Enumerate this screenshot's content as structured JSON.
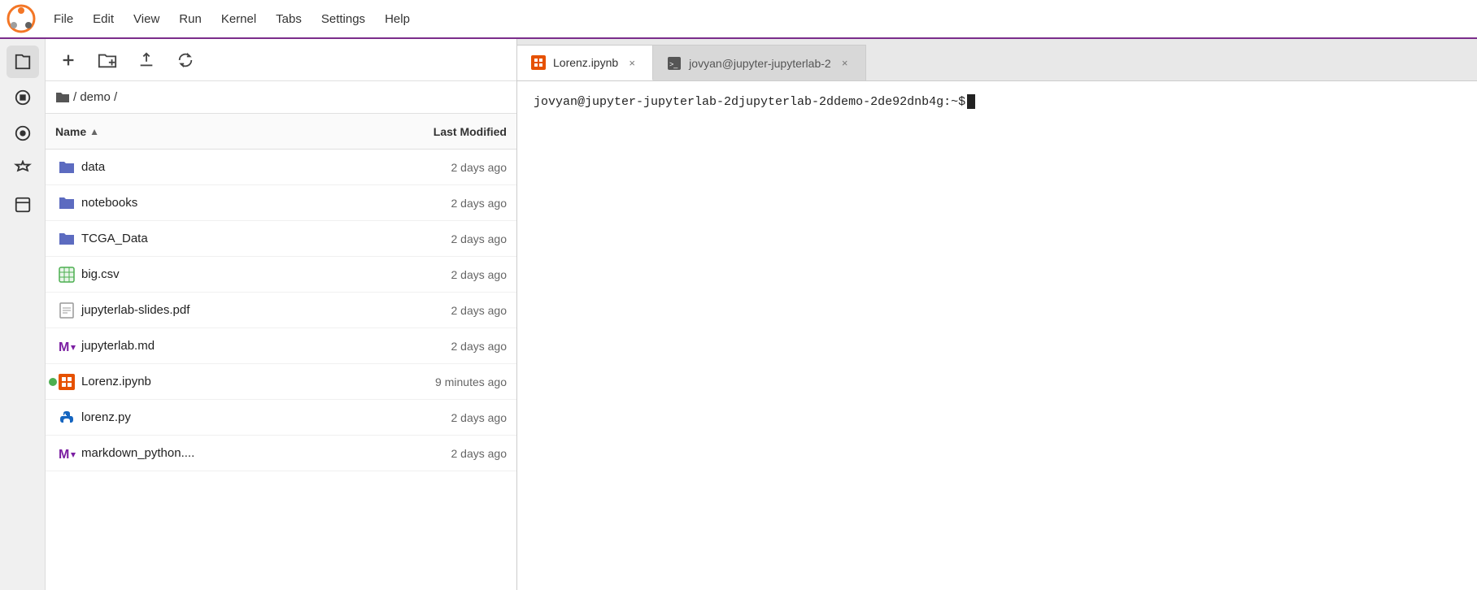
{
  "menubar": {
    "items": [
      "File",
      "Edit",
      "View",
      "Run",
      "Kernel",
      "Tabs",
      "Settings",
      "Help"
    ]
  },
  "activity_bar": {
    "icons": [
      {
        "name": "folder-icon",
        "symbol": "📁"
      },
      {
        "name": "circle-icon",
        "symbol": "⬤"
      },
      {
        "name": "palette-icon",
        "symbol": "🎨"
      },
      {
        "name": "wrench-icon",
        "symbol": "🔧"
      },
      {
        "name": "pages-icon",
        "symbol": "📄"
      }
    ]
  },
  "file_panel": {
    "toolbar": {
      "new_file_label": "+",
      "new_folder_label": "📁+",
      "upload_label": "⬆",
      "refresh_label": "↻"
    },
    "breadcrumb": "/ demo /",
    "columns": {
      "name": "Name",
      "modified": "Last Modified"
    },
    "files": [
      {
        "name": "data",
        "type": "folder",
        "modified": "2 days ago",
        "active_dot": false
      },
      {
        "name": "notebooks",
        "type": "folder",
        "modified": "2 days ago",
        "active_dot": false
      },
      {
        "name": "TCGA_Data",
        "type": "folder",
        "modified": "2 days ago",
        "active_dot": false
      },
      {
        "name": "big.csv",
        "type": "csv",
        "modified": "2 days ago",
        "active_dot": false
      },
      {
        "name": "jupyterlab-slides.pdf",
        "type": "pdf",
        "modified": "2 days ago",
        "active_dot": false
      },
      {
        "name": "jupyterlab.md",
        "type": "md",
        "modified": "2 days ago",
        "active_dot": false
      },
      {
        "name": "Lorenz.ipynb",
        "type": "notebook",
        "modified": "9 minutes ago",
        "active_dot": true
      },
      {
        "name": "lorenz.py",
        "type": "python",
        "modified": "2 days ago",
        "active_dot": false
      },
      {
        "name": "markdown_python....",
        "type": "md",
        "modified": "2 days ago",
        "active_dot": false
      }
    ]
  },
  "tabs": [
    {
      "label": "Lorenz.ipynb",
      "type": "notebook",
      "active": true
    },
    {
      "label": "jovyan@jupyter-jupyterlab-2",
      "type": "terminal",
      "active": false
    }
  ],
  "terminal": {
    "prompt": "jovyan@jupyter-jupyterlab-2djupyterlab-2ddemo-2de92dnb4g:~$"
  }
}
